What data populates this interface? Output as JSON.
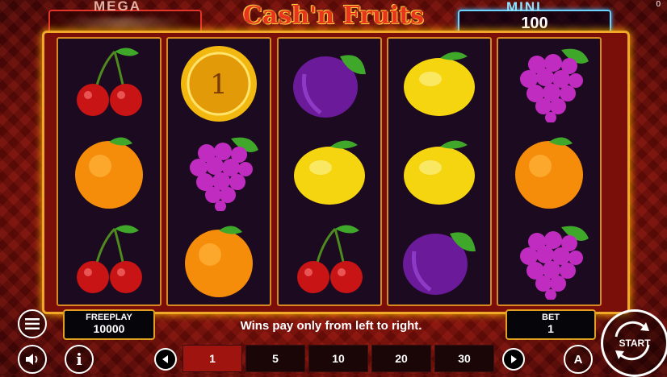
{
  "title": "Cash'n Fruits",
  "jackpots": {
    "mega_label": "MEGA",
    "mini_label": "MINI",
    "mini_value": "100"
  },
  "reels": [
    [
      "cherry",
      "orange",
      "cherry"
    ],
    [
      "coin",
      "grapes",
      "orange"
    ],
    [
      "plum",
      "lemon",
      "cherry"
    ],
    [
      "lemon",
      "lemon",
      "plum"
    ],
    [
      "grapes",
      "orange",
      "grapes"
    ]
  ],
  "coin_value": "1",
  "freeplay": {
    "label": "FREEPLAY",
    "value": "10000"
  },
  "bet": {
    "label": "BET",
    "value": "1"
  },
  "message": "Wins pay only from left to right.",
  "lines": {
    "options": [
      "1",
      "5",
      "10",
      "20",
      "30"
    ],
    "selected": "1"
  },
  "start_label": "START",
  "autoplay_label": "A",
  "corner_text": "0",
  "colors": {
    "frame": "#f0a828",
    "title": "#e8341c",
    "mini_border": "#6fd3ff",
    "mega_border": "#e3342a"
  }
}
